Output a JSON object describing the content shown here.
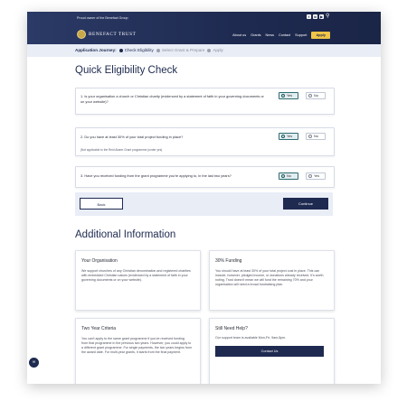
{
  "header": {
    "proud_text": "Proud owner of the Benefact Group",
    "social_icons": [
      "facebook-icon",
      "linkedin-icon",
      "youtube-icon",
      "search-icon"
    ],
    "logo_text": "BENEFACT TRUST",
    "nav_items": [
      "About us",
      "Grants",
      "News",
      "Contact",
      "Support"
    ],
    "apply_label": "Apply",
    "brand_color": "#1e2a50",
    "accent_color": "#f0c447"
  },
  "journey": {
    "title": "Application Journey:",
    "steps": [
      {
        "label": "Check Eligibility",
        "active": true
      },
      {
        "label": "Select Grant & Prepare",
        "active": false
      },
      {
        "label": "Apply",
        "active": false
      }
    ]
  },
  "eligibility": {
    "heading": "Quick Eligibility Check",
    "questions": [
      {
        "text": "1. Is your organisation a church or Christian charity (evidenced by a statement of faith in your governing documents or on your website)?",
        "note": "",
        "options": [
          "Yes",
          "No"
        ],
        "selected": "Yes"
      },
      {
        "text": "2. Do you have at least 30% of your total project funding in place?",
        "note": "(Not applicable to the Reid Alaem Grant programme (under yes)",
        "options": [
          "Yes",
          "No"
        ],
        "selected": "Yes"
      },
      {
        "text": "3. Have you received funding from the grant programme you're applying to, in the last two years?",
        "note": "",
        "options": [
          "No",
          "Yes"
        ],
        "selected": "No"
      }
    ],
    "back_label": "Back",
    "continue_label": "Continue"
  },
  "additional": {
    "heading": "Additional Information",
    "cards": [
      {
        "title": "Your Organisation",
        "body": "We support churches of any Christian denomination and registered charities with embedded Christian values (evidenced by a statement of faith in your governing documents or on your website)."
      },
      {
        "title": "30% Funding",
        "body": "You should have at least 30% of your total project cost in place. This can include, however, pledged income, or donations already received. It's worth noting, Trust doesn't mean we will fund the remaining 70% and your organisation will need a broad fundraising plan."
      },
      {
        "title": "Two Year Criteria",
        "body": "You can't apply to the same grant programme if you've received funding from that programme in the previous two years. However, you could apply to a different grant programme. For single payments, the two years begins from the award date. For multi-year grants, it starts from the final payment."
      },
      {
        "title": "Still Need Help?",
        "body": "Our support team is available Mon-Fri, 9am-5pm.",
        "button_label": "Contact Us"
      }
    ]
  },
  "accessibility_icon": "accessibility-icon"
}
